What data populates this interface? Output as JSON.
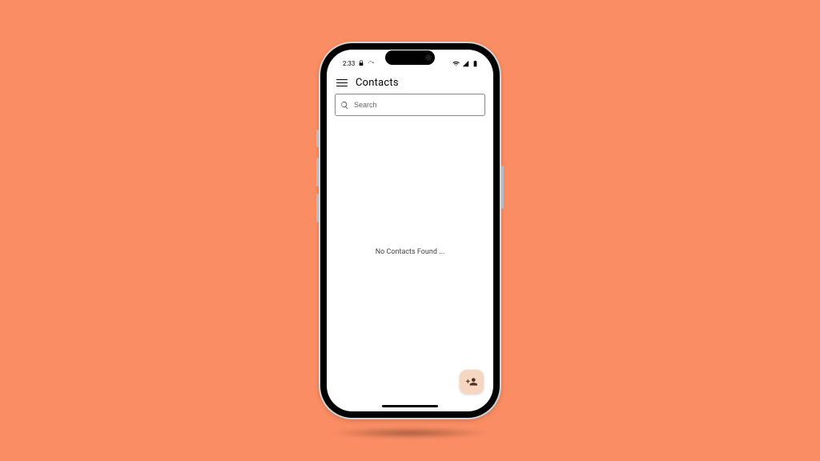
{
  "status": {
    "time": "2:33"
  },
  "app": {
    "title": "Contacts"
  },
  "search": {
    "placeholder": "Search",
    "value": ""
  },
  "content": {
    "empty_message": "No Contacts Found ..."
  },
  "colors": {
    "background": "#fa8d63",
    "fab": "#f7d6c1"
  }
}
